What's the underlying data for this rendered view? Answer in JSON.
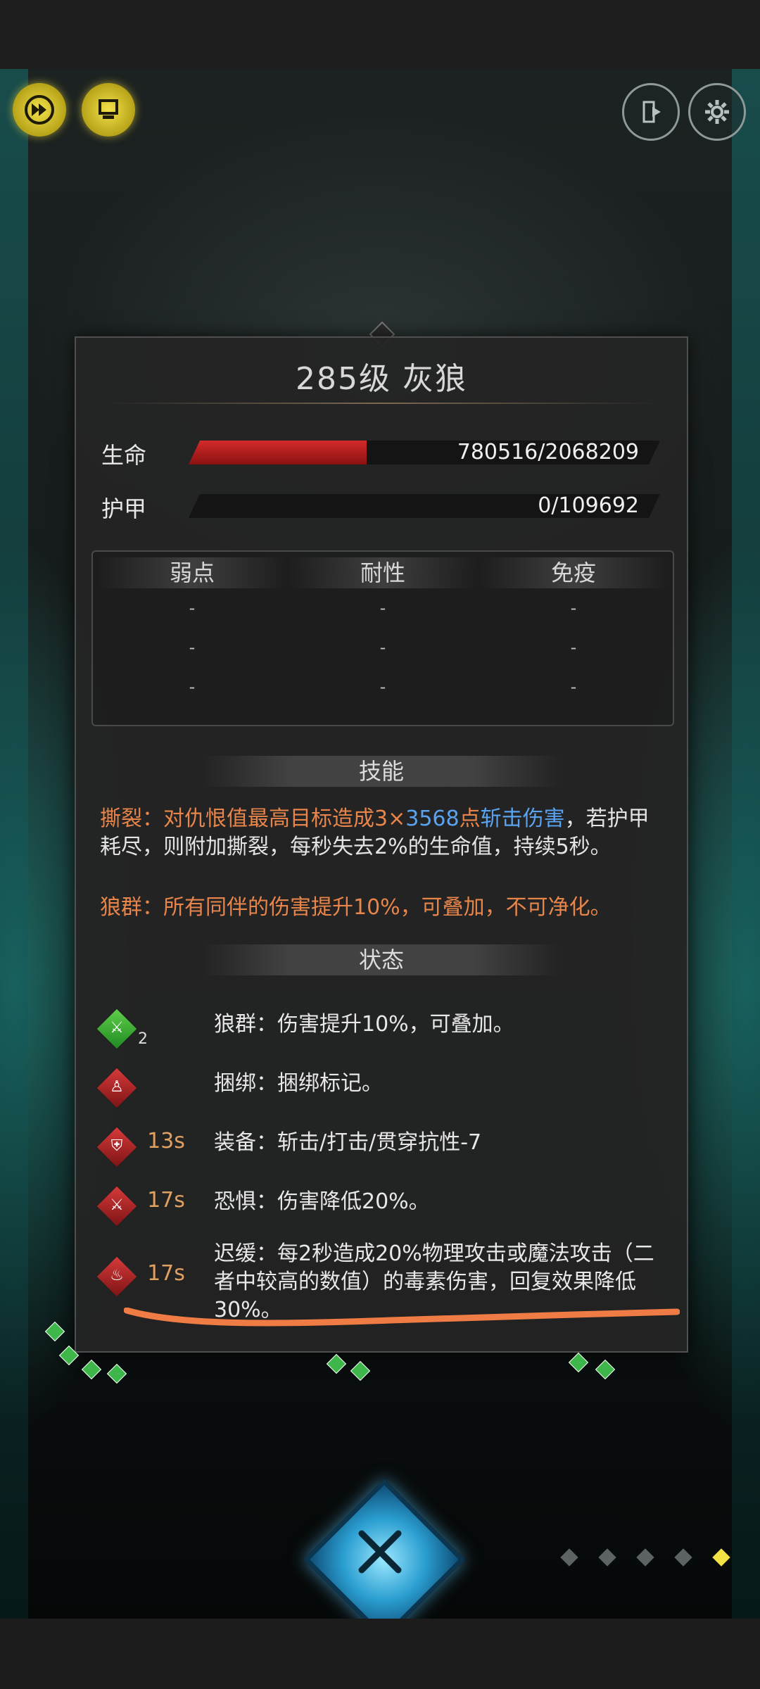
{
  "header": {
    "fast_forward_icon": "fast-forward-icon",
    "auto_icon": "monitor-icon",
    "exit_icon": "exit-icon",
    "settings_icon": "gear-icon"
  },
  "enemy": {
    "title": "285级  灰狼",
    "hp_label": "生命",
    "hp_value": "780516/2068209",
    "hp_fraction": 0.377,
    "armor_label": "护甲",
    "armor_value": "0/109692",
    "armor_fraction": 0.0
  },
  "resistances": {
    "headers": [
      "弱点",
      "耐性",
      "免疫"
    ],
    "rows": [
      [
        "-",
        "-",
        "-"
      ],
      [
        "-",
        "-",
        "-"
      ],
      [
        "-",
        "-",
        "-"
      ]
    ]
  },
  "skills": {
    "heading": "技能",
    "skill1_name": "撕裂：",
    "skill1_pre": "对仇恨值最高目标造成3×",
    "skill1_num": "3568",
    "skill1_mid": "点",
    "skill1_dmg": "斩击伤害",
    "skill1_post": "，若护甲耗尽，则附加撕裂，每秒失去2%的生命值，持续5秒。",
    "skill2": "狼群：所有同伴的伤害提升10%，可叠加，不可净化。"
  },
  "status": {
    "heading": "状态",
    "items": [
      {
        "icon": "sword-up-icon",
        "color": "green",
        "stack": "2",
        "duration": "",
        "text": "狼群：伤害提升10%，可叠加。"
      },
      {
        "icon": "bind-icon",
        "color": "red",
        "stack": "",
        "duration": "",
        "text": "捆绑：捆绑标记。"
      },
      {
        "icon": "shield-icon",
        "color": "red",
        "stack": "",
        "duration": "13s",
        "text": "装备：斩击/打击/贯穿抗性-7"
      },
      {
        "icon": "sword-down-icon",
        "color": "red",
        "stack": "",
        "duration": "17s",
        "text": "恐惧：伤害降低20%。"
      },
      {
        "icon": "poison-drops-icon",
        "color": "red",
        "stack": "",
        "duration": "17s",
        "text": "迟缓：每2秒造成20%物理攻击或魔法攻击（二者中较高的数值）的毒素伤害，回复效果降低30%。"
      }
    ]
  },
  "pagination": {
    "count": 5,
    "active": 4
  },
  "colors": {
    "hp": "#c41e1e",
    "accent": "#e8854a",
    "link": "#5aa3f0",
    "duration": "#e0a062",
    "annotation": "#f07c45"
  }
}
